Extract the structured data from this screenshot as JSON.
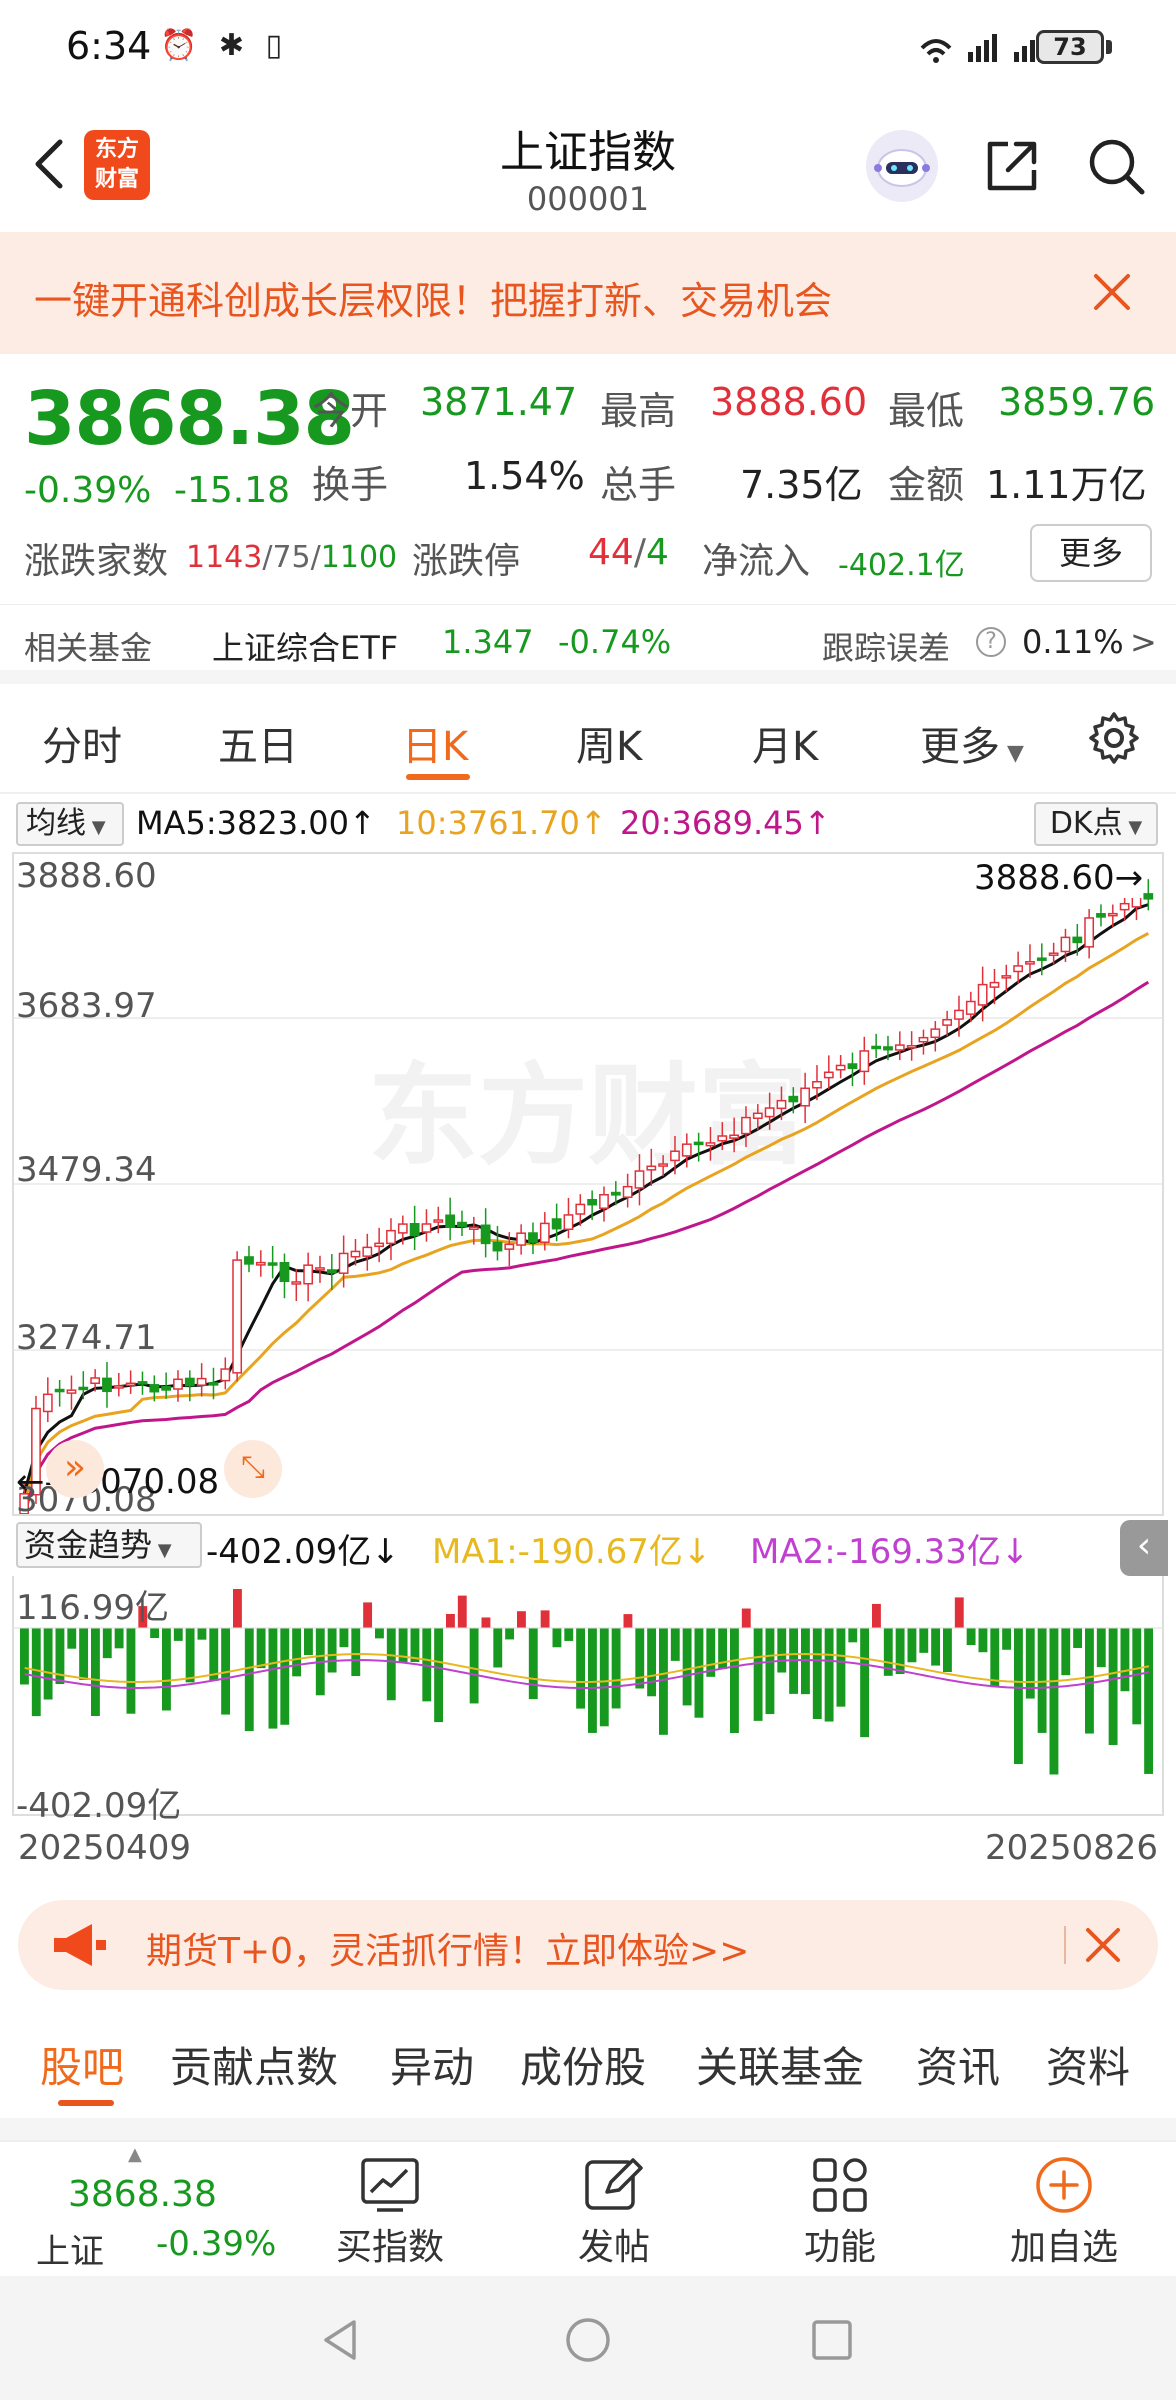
{
  "status_bar": {
    "time": "6:34",
    "battery": "73",
    "network_label": "5G 4G"
  },
  "header": {
    "logo_text_1": "东方",
    "logo_text_2": "财富",
    "title": "上证指数",
    "code": "000001"
  },
  "promo": {
    "text": "一键开通科创成长层权限！把握打新、交易机会"
  },
  "quote": {
    "price": "3868.38",
    "change_pct": "-0.39%",
    "change_abs": "-15.18",
    "open_label": "今开",
    "open": "3871.47",
    "high_label": "最高",
    "high": "3888.60",
    "low_label": "最低",
    "low": "3859.76",
    "turnover_label": "换手",
    "turnover": "1.54%",
    "volume_label": "总手",
    "volume": "7.35亿",
    "amount_label": "金额",
    "amount": "1.11万亿",
    "breadth_label": "涨跌家数",
    "breadth_up": "1143",
    "breadth_flat": "75",
    "breadth_down": "1100",
    "limit_label": "涨跌停",
    "limit_up": "44",
    "limit_down": "4",
    "netflow_label": "净流入",
    "netflow": "-402.1亿",
    "more_label": "更多"
  },
  "fund": {
    "label": "相关基金",
    "name": "上证综合ETF",
    "price": "1.347",
    "change": "-0.74%",
    "tracking_label": "跟踪误差",
    "tracking_value": "0.11%",
    "arrow": ">"
  },
  "chart_tabs": [
    "分时",
    "五日",
    "日K",
    "周K",
    "月K",
    "更多"
  ],
  "ma_row": {
    "selector": "均线",
    "ma5": "MA5:3823.00↑",
    "ma10": "10:3761.70↑",
    "ma20": "20:3689.45↑",
    "dk_label": "DK点"
  },
  "kchart": {
    "ylabels": [
      "3888.60",
      "3683.97",
      "3479.34",
      "3274.71",
      "3070.08"
    ],
    "high_marker": "3888.60",
    "low_marker": "3070.08",
    "watermark": "东方财富"
  },
  "flow": {
    "selector": "资金趋势",
    "value": "-402.09亿↓",
    "ma1": "MA1:-190.67亿↓",
    "ma2": "MA2:-169.33亿↓",
    "top_label": "116.99亿",
    "bottom_label": "-402.09亿",
    "start_date": "20250409",
    "end_date": "20250826"
  },
  "futures_banner": {
    "text": "期货T+0，灵活抓行情！立即体验>>"
  },
  "bottom_tabs": [
    "股吧",
    "贡献点数",
    "异动",
    "成份股",
    "关联基金",
    "资讯",
    "资料"
  ],
  "toolbar": {
    "index_price": "3868.38",
    "index_name": "上证",
    "index_change": "-0.39%",
    "buy_label": "买指数",
    "post_label": "发帖",
    "func_label": "功能",
    "add_label": "加自选"
  },
  "colors": {
    "up": "#e0313b",
    "down": "#17991f",
    "accent": "#f06a1c",
    "ma5": "#111111",
    "ma10": "#e8a420",
    "ma20": "#c0168c"
  }
}
